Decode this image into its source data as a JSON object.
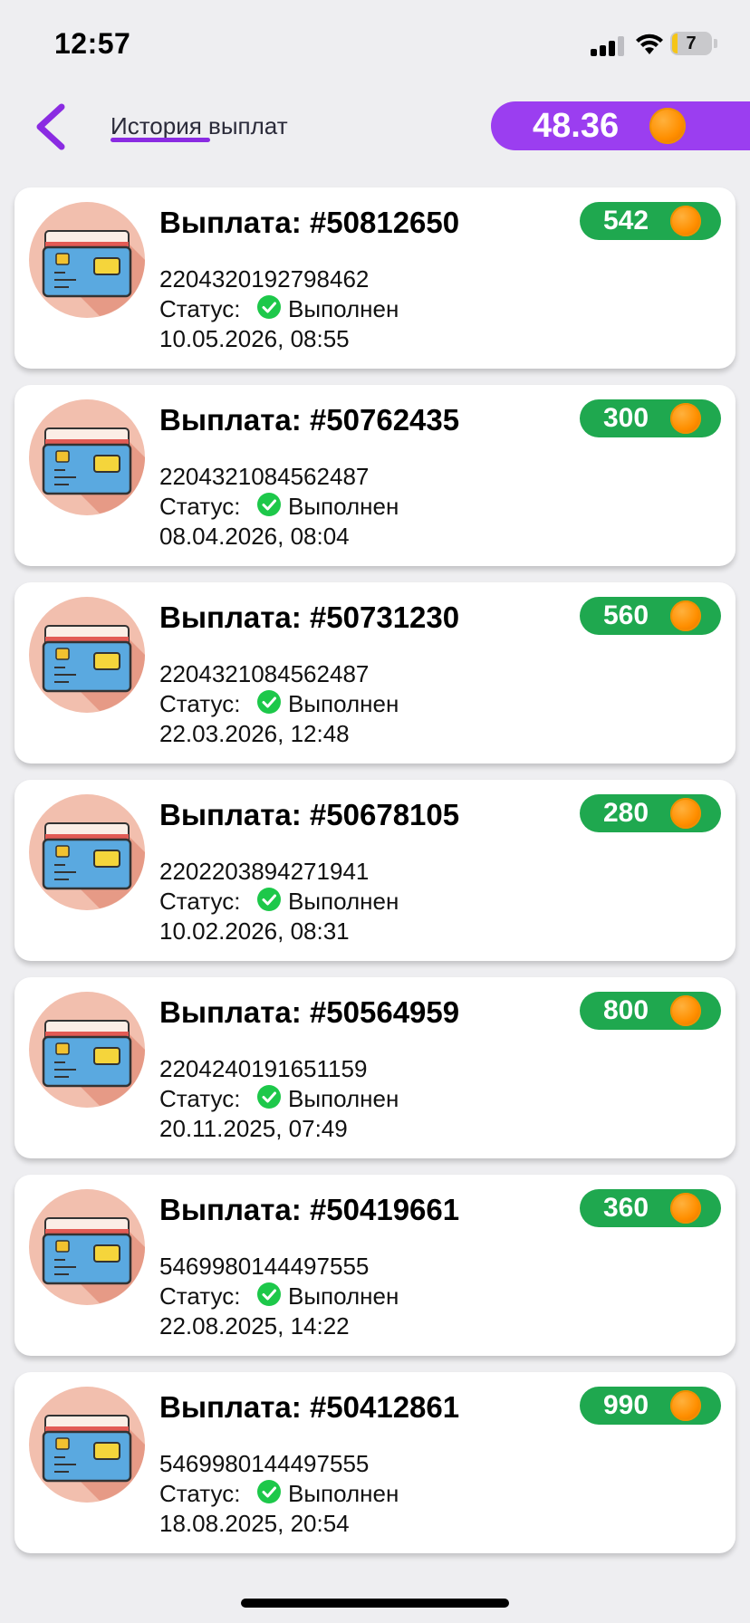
{
  "status_bar": {
    "time": "12:57",
    "battery": "7"
  },
  "header": {
    "title": "История выплат",
    "balance": "48.36"
  },
  "payouts": [
    {
      "title": "Выплата: #50812650",
      "amount": "542",
      "card_number": "2204320192798462",
      "status_label": "Статус:",
      "status": "Выполнен",
      "date": "10.05.2026, 08:55"
    },
    {
      "title": "Выплата: #50762435",
      "amount": "300",
      "card_number": "2204321084562487",
      "status_label": "Статус:",
      "status": "Выполнен",
      "date": "08.04.2026, 08:04"
    },
    {
      "title": "Выплата: #50731230",
      "amount": "560",
      "card_number": "2204321084562487",
      "status_label": "Статус:",
      "status": "Выполнен",
      "date": "22.03.2026, 12:48"
    },
    {
      "title": "Выплата: #50678105",
      "amount": "280",
      "card_number": "2202203894271941",
      "status_label": "Статус:",
      "status": "Выполнен",
      "date": "10.02.2026, 08:31"
    },
    {
      "title": "Выплата: #50564959",
      "amount": "800",
      "card_number": "2204240191651159",
      "status_label": "Статус:",
      "status": "Выполнен",
      "date": "20.11.2025, 07:49"
    },
    {
      "title": "Выплата: #50419661",
      "amount": "360",
      "card_number": "5469980144497555",
      "status_label": "Статус:",
      "status": "Выполнен",
      "date": "22.08.2025, 14:22"
    },
    {
      "title": "Выплата: #50412861",
      "amount": "990",
      "card_number": "5469980144497555",
      "status_label": "Статус:",
      "status": "Выполнен",
      "date": "18.08.2025, 20:54"
    }
  ],
  "icons": {
    "back": "chevron-left-icon",
    "coin": "coin-icon",
    "card": "credit-card-icon",
    "status": "check-circle-icon"
  },
  "colors": {
    "accent": "#9b3ef0",
    "amount_badge": "#1fa84f",
    "status_ok": "#1dc84a",
    "coin": "#ff8f00"
  }
}
